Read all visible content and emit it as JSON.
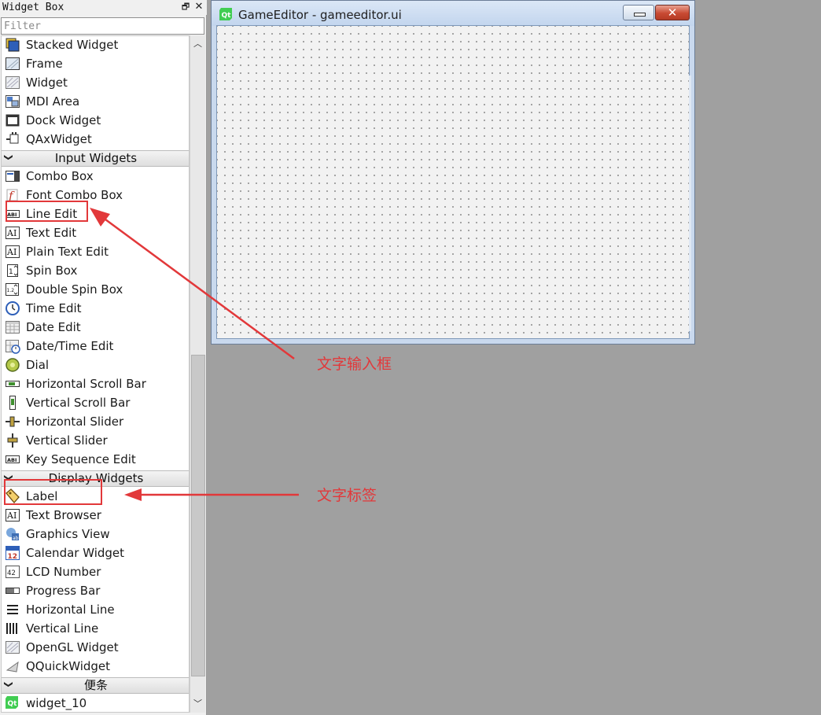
{
  "widget_box": {
    "title": "Widget Box",
    "float_icon": "float-icon",
    "close_icon": "close-icon",
    "filter_placeholder": "Filter",
    "rows": [
      {
        "kind": "item",
        "label": "Stacked Widget",
        "icon": "stacked-widget-icon"
      },
      {
        "kind": "item",
        "label": "Frame",
        "icon": "frame-icon"
      },
      {
        "kind": "item",
        "label": "Widget",
        "icon": "widget-icon"
      },
      {
        "kind": "item",
        "label": "MDI Area",
        "icon": "mdi-area-icon"
      },
      {
        "kind": "item",
        "label": "Dock Widget",
        "icon": "dock-widget-icon"
      },
      {
        "kind": "item",
        "label": "QAxWidget",
        "icon": "qaxwidget-icon"
      },
      {
        "kind": "category",
        "label": "Input Widgets"
      },
      {
        "kind": "item",
        "label": "Combo Box",
        "icon": "combo-box-icon"
      },
      {
        "kind": "item",
        "label": "Font Combo Box",
        "icon": "font-combo-box-icon"
      },
      {
        "kind": "item",
        "label": "Line Edit",
        "icon": "line-edit-icon"
      },
      {
        "kind": "item",
        "label": "Text Edit",
        "icon": "text-edit-icon"
      },
      {
        "kind": "item",
        "label": "Plain Text Edit",
        "icon": "plain-text-edit-icon"
      },
      {
        "kind": "item",
        "label": "Spin Box",
        "icon": "spin-box-icon"
      },
      {
        "kind": "item",
        "label": "Double Spin Box",
        "icon": "double-spin-box-icon"
      },
      {
        "kind": "item",
        "label": "Time Edit",
        "icon": "time-edit-icon"
      },
      {
        "kind": "item",
        "label": "Date Edit",
        "icon": "date-edit-icon"
      },
      {
        "kind": "item",
        "label": "Date/Time Edit",
        "icon": "date-time-edit-icon"
      },
      {
        "kind": "item",
        "label": "Dial",
        "icon": "dial-icon"
      },
      {
        "kind": "item",
        "label": "Horizontal Scroll Bar",
        "icon": "horizontal-scroll-bar-icon"
      },
      {
        "kind": "item",
        "label": "Vertical Scroll Bar",
        "icon": "vertical-scroll-bar-icon"
      },
      {
        "kind": "item",
        "label": "Horizontal Slider",
        "icon": "horizontal-slider-icon"
      },
      {
        "kind": "item",
        "label": "Vertical Slider",
        "icon": "vertical-slider-icon"
      },
      {
        "kind": "item",
        "label": "Key Sequence Edit",
        "icon": "key-sequence-edit-icon"
      },
      {
        "kind": "category",
        "label": "Display Widgets"
      },
      {
        "kind": "item",
        "label": "Label",
        "icon": "label-icon"
      },
      {
        "kind": "item",
        "label": "Text Browser",
        "icon": "text-browser-icon"
      },
      {
        "kind": "item",
        "label": "Graphics View",
        "icon": "graphics-view-icon"
      },
      {
        "kind": "item",
        "label": "Calendar Widget",
        "icon": "calendar-widget-icon"
      },
      {
        "kind": "item",
        "label": "LCD Number",
        "icon": "lcd-number-icon"
      },
      {
        "kind": "item",
        "label": "Progress Bar",
        "icon": "progress-bar-icon"
      },
      {
        "kind": "item",
        "label": "Horizontal Line",
        "icon": "horizontal-line-icon"
      },
      {
        "kind": "item",
        "label": "Vertical Line",
        "icon": "vertical-line-icon"
      },
      {
        "kind": "item",
        "label": "OpenGL Widget",
        "icon": "opengl-widget-icon"
      },
      {
        "kind": "item",
        "label": "QQuickWidget",
        "icon": "qquickwidget-icon"
      },
      {
        "kind": "category",
        "label": "便条"
      },
      {
        "kind": "item",
        "label": "widget_10",
        "icon": "qt-widget-icon"
      }
    ],
    "scroll": {
      "up_icon": "scroll-up-icon",
      "down_icon": "scroll-down-icon",
      "thumb_start": 0.47,
      "thumb_size": 0.5
    }
  },
  "form_window": {
    "title": "GameEditor - gameeditor.ui",
    "app_icon": "qt-logo-icon",
    "minimize_icon": "minimize-icon",
    "close_label": "✕"
  },
  "annotations": [
    {
      "text": "文字输入框",
      "target": "Line Edit",
      "color": "#e2383a"
    },
    {
      "text": "文字标签",
      "target": "Label",
      "color": "#e2383a"
    }
  ]
}
